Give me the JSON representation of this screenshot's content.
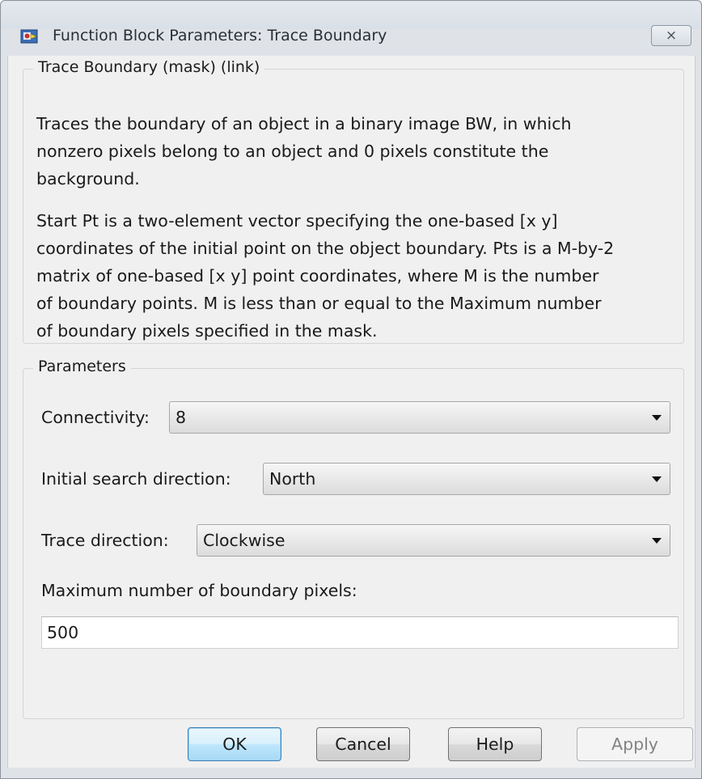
{
  "window": {
    "title": "Function Block Parameters: Trace Boundary",
    "icon": "simulink-block-icon",
    "close_icon": "close-icon",
    "close_glyph": "⨯"
  },
  "description": {
    "group_title": "Trace Boundary (mask) (link)",
    "lines": [
      "Traces the boundary of an object in a binary image BW, in which",
      "nonzero pixels belong to an object and  0 pixels constitute the",
      "background.",
      "",
      "Start Pt is a two-element vector specifying the one-based [x y]",
      "coordinates of the initial point on the object boundary. Pts is a M-by-2",
      "matrix of one-based [x y] point coordinates, where M is the number",
      "of boundary points. M is less than or equal to the Maximum number",
      "of boundary pixels specified in the mask."
    ]
  },
  "parameters": {
    "group_title": "Parameters",
    "connectivity": {
      "label": "Connectivity:",
      "value": "8"
    },
    "initial_search_direction": {
      "label": "Initial search direction:",
      "value": "North"
    },
    "trace_direction": {
      "label": "Trace direction:",
      "value": "Clockwise"
    },
    "max_boundary_pixels": {
      "label": "Maximum number of boundary pixels:",
      "value": "500"
    }
  },
  "buttons": {
    "ok": "OK",
    "cancel": "Cancel",
    "help": "Help",
    "apply": "Apply"
  }
}
